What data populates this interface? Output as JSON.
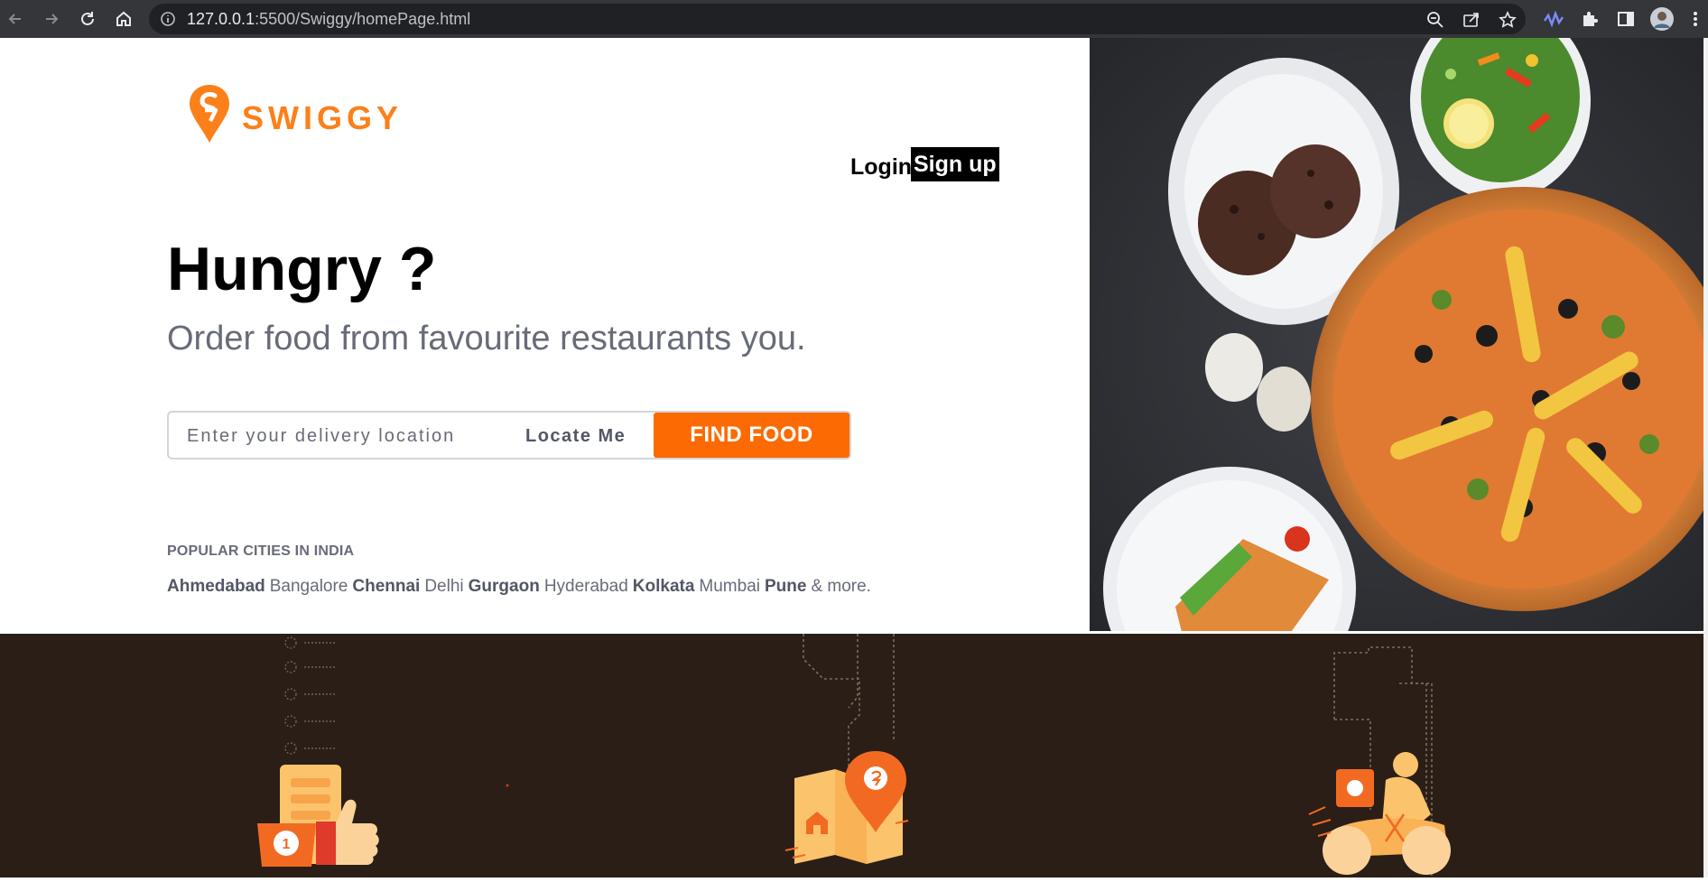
{
  "browser": {
    "url_host": "127.0.0.1",
    "url_rest": ":5500/Swiggy/homePage.html"
  },
  "brand": {
    "name": "SWIGGY",
    "color": "#fc8019"
  },
  "nav": {
    "login_label": "Login",
    "signup_label": "Sign up"
  },
  "hero": {
    "headline": "Hungry ?",
    "subheadline": "Order food from favourite restaurants you."
  },
  "search": {
    "placeholder": "Enter your delivery location",
    "value": "",
    "locate_label": "Locate Me",
    "find_label": "FIND FOOD",
    "find_color": "#fc6b03"
  },
  "popular": {
    "title": "POPULAR CITIES IN INDIA",
    "cities": [
      {
        "name": "Ahmedabad",
        "bold": true
      },
      {
        "name": "Bangalore",
        "bold": false
      },
      {
        "name": "Chennai",
        "bold": true
      },
      {
        "name": "Delhi",
        "bold": false
      },
      {
        "name": "Gurgaon",
        "bold": true
      },
      {
        "name": "Hyderabad",
        "bold": false
      },
      {
        "name": "Kolkata",
        "bold": true
      },
      {
        "name": "Mumbai",
        "bold": false
      },
      {
        "name": "Pune",
        "bold": true
      }
    ],
    "more": "& more."
  },
  "icons": {
    "back": "arrow-left-icon",
    "forward": "arrow-right-icon",
    "reload": "reload-icon",
    "home": "home-icon",
    "info": "info-icon",
    "zoom": "zoom-icon",
    "share": "share-icon",
    "bookmark": "star-icon",
    "extension_wave": "wave-extension-icon",
    "extensions": "puzzle-icon",
    "sidepanel": "side-panel-icon",
    "profile": "profile-avatar",
    "menu": "kebab-menu-icon"
  },
  "bottom": {
    "bg_color": "#2b1e16",
    "illustrations": [
      "order-checklist-illustration",
      "map-location-illustration",
      "delivery-scooter-illustration"
    ]
  }
}
